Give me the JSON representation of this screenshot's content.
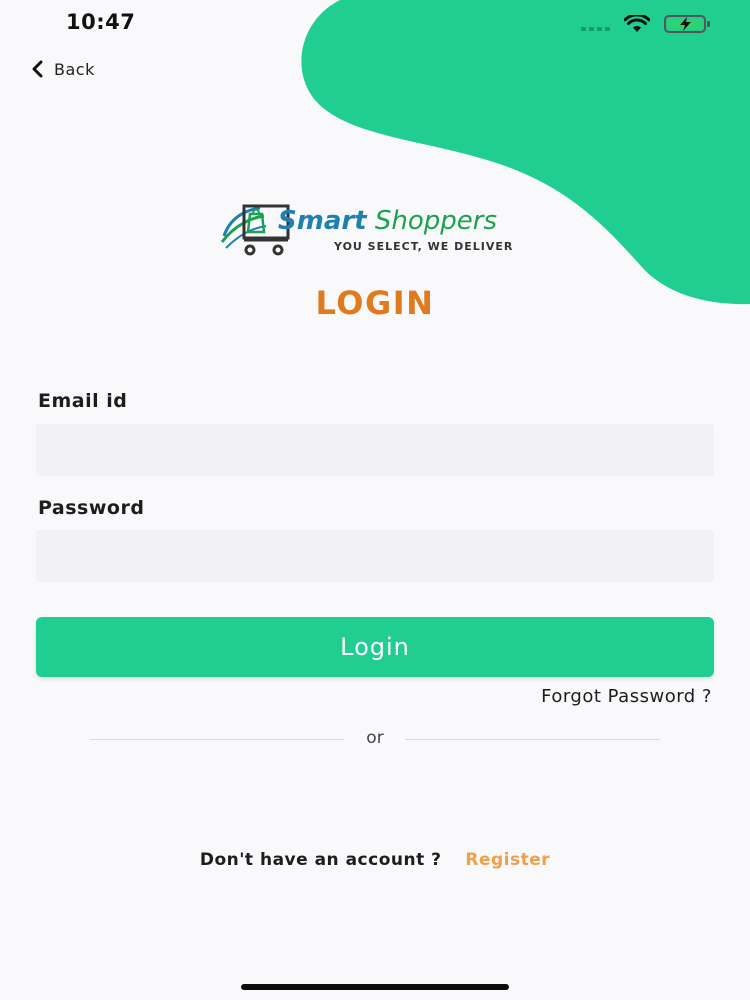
{
  "status_bar": {
    "time": "10:47",
    "icons": [
      "signal-icon",
      "wifi-icon",
      "battery-charging-icon"
    ]
  },
  "nav": {
    "back_label": "Back"
  },
  "logo": {
    "name_part1": "Smart",
    "name_part2": "Shoppers",
    "tagline": "YOU SELECT, WE DELIVER"
  },
  "heading": "LOGIN",
  "form": {
    "email_label": "Email id",
    "email_value": "",
    "email_placeholder": "",
    "password_label": "Password",
    "password_value": "",
    "password_placeholder": "",
    "login_button": "Login",
    "forgot_link": "Forgot Password ?"
  },
  "separator_text": "or",
  "register": {
    "prompt": "Don't have an account ?",
    "link": "Register"
  },
  "colors": {
    "accent_green": "#1fce90",
    "heading_orange": "#e07a1f",
    "register_orange": "#f0a04b",
    "input_bg": "#f2f2f4"
  }
}
